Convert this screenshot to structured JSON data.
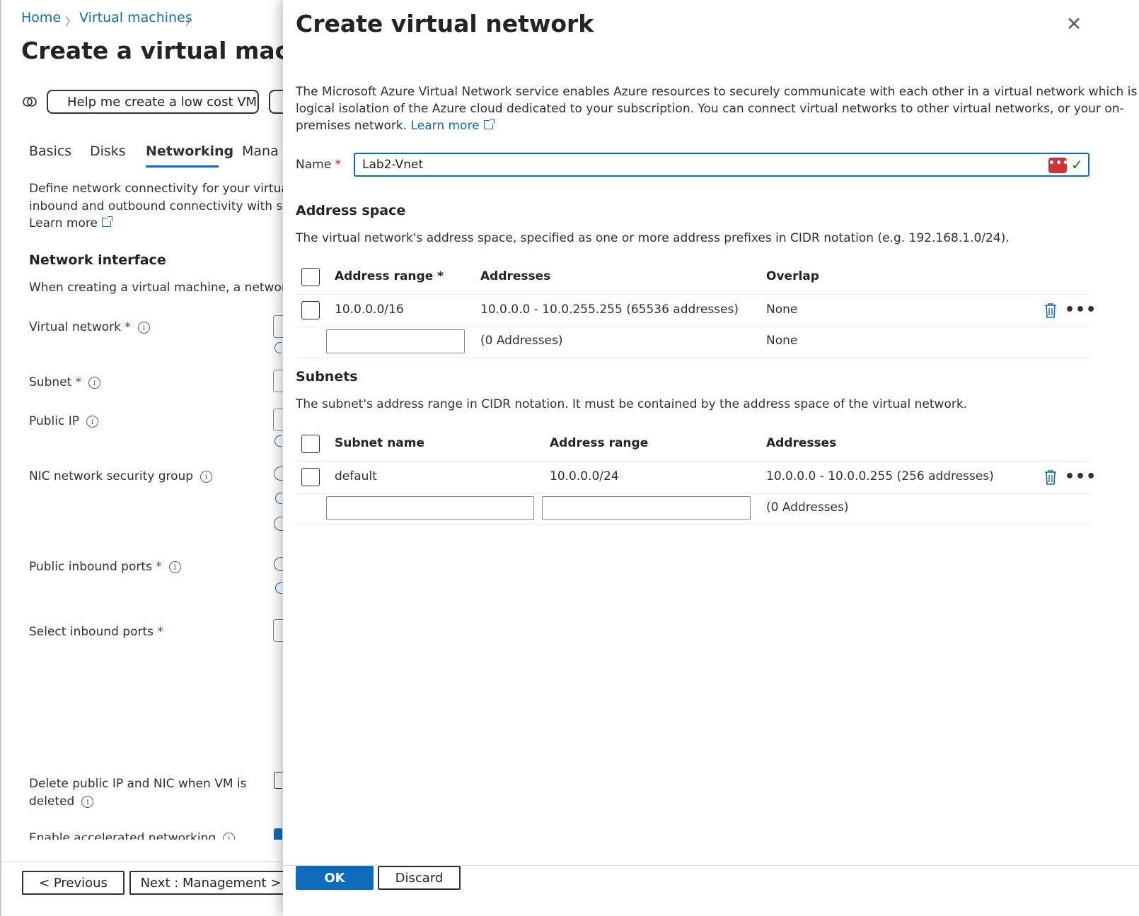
{
  "breadcrumb": {
    "home": "Home",
    "virtual_machines": "Virtual machines"
  },
  "left_page": {
    "title": "Create a virtual machine",
    "help_button": "Help me create a low cost VM",
    "tabs": [
      "Basics",
      "Disks",
      "Networking",
      "Mana"
    ],
    "active_tab": "Networking",
    "description_line1": "Define network connectivity for your virtual r",
    "description_line2": "inbound and outbound connectivity with sec",
    "learn_more": "Learn more",
    "network_interface": {
      "title": "Network interface",
      "text": "When creating a virtual machine, a network i"
    },
    "fields": {
      "virtual_network": "Virtual network",
      "subnet": "Subnet",
      "public_ip": "Public IP",
      "nic_nsg": "NIC network security group",
      "public_inbound_ports": "Public inbound ports",
      "select_inbound_ports": "Select inbound ports",
      "delete_public_ip_line1": "Delete public IP and NIC when VM is",
      "delete_public_ip_line2": "deleted",
      "accelerated_networking": "Enable accelerated networking"
    },
    "required_mark": "*",
    "info_glyph": "i",
    "footer": {
      "previous": "< Previous",
      "next": "Next : Management >"
    }
  },
  "panel": {
    "title": "Create virtual network",
    "close_glyph": "✕",
    "description": "The Microsoft Azure Virtual Network service enables Azure resources to securely communicate with each other in a virtual network which is a logical isolation of the Azure cloud dedicated to your subscription. You can connect virtual networks to other virtual networks, or your on-premises network.",
    "description_line1": "The Microsoft Azure Virtual Network service enables Azure resources to securely communicate with each other in a virtual network which is a",
    "description_line2": "logical isolation of the Azure cloud dedicated to your subscription. You can connect virtual networks to other virtual networks, or your on-",
    "description_line3": "premises network.",
    "learn_more": "Learn more",
    "name_label": "Name",
    "name_value": "Lab2-Vnet",
    "name_icon_glyph": "•••",
    "name_check_glyph": "✓",
    "address_space": {
      "title": "Address space",
      "description": "The virtual network's address space, specified as one or more address prefixes in CIDR notation (e.g. 192.168.1.0/24).",
      "headers": {
        "address_range": "Address range *",
        "addresses": "Addresses",
        "overlap": "Overlap"
      },
      "rows": [
        {
          "address_range": "10.0.0.0/16",
          "addresses": "10.0.0.0 - 10.0.255.255 (65536 addresses)",
          "overlap": "None"
        }
      ],
      "new_row": {
        "addresses": "(0 Addresses)",
        "overlap": "None"
      }
    },
    "subnets": {
      "title": "Subnets",
      "description": "The subnet's address range in CIDR notation. It must be contained by the address space of the virtual network.",
      "headers": {
        "subnet_name": "Subnet name",
        "address_range": "Address range",
        "addresses": "Addresses"
      },
      "rows": [
        {
          "subnet_name": "default",
          "address_range": "10.0.0.0/24",
          "addresses": "10.0.0.0 - 10.0.0.255 (256 addresses)"
        }
      ],
      "new_row": {
        "addresses": "(0 Addresses)"
      }
    },
    "more_glyph": "•••",
    "footer": {
      "ok": "OK",
      "discard": "Discard"
    }
  },
  "colors": {
    "accent": "#0f6cbd",
    "required": "#a4262c",
    "text": "#323130",
    "success": "#107c10",
    "password_manager": "#d13438"
  }
}
